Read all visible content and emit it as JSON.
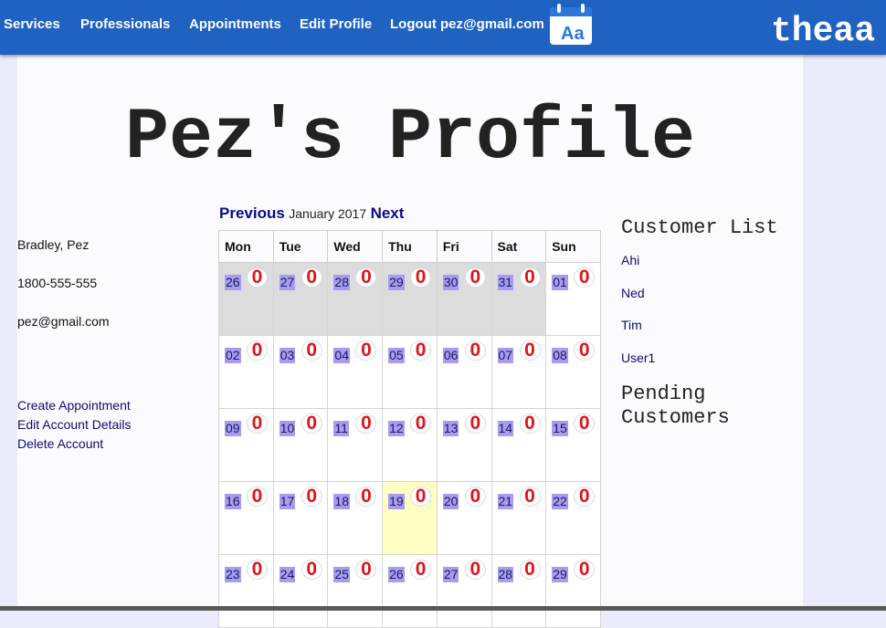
{
  "nav": {
    "items": [
      {
        "label": "Services"
      },
      {
        "label": "Professionals"
      },
      {
        "label": "Appointments"
      },
      {
        "label": "Edit Profile"
      },
      {
        "label": "Logout pez@gmail.com"
      }
    ],
    "brand_icon": "calendar-icon",
    "brand_icon_text": "Aa",
    "brand_text": "theaa"
  },
  "page_title": "Pez's Profile",
  "profile": {
    "name": "Bradley, Pez",
    "phone": "1800-555-555",
    "email": "pez@gmail.com"
  },
  "actions": [
    {
      "label": "Create Appointment"
    },
    {
      "label": "Edit Account Details"
    },
    {
      "label": "Delete Account"
    }
  ],
  "calendar": {
    "prev_label": "Previous",
    "month_label": "January 2017",
    "next_label": "Next",
    "day_headers": [
      "Mon",
      "Tue",
      "Wed",
      "Thu",
      "Fri",
      "Sat",
      "Sun"
    ],
    "weeks": [
      [
        {
          "day": "26",
          "count": "0",
          "other": true
        },
        {
          "day": "27",
          "count": "0",
          "other": true
        },
        {
          "day": "28",
          "count": "0",
          "other": true
        },
        {
          "day": "29",
          "count": "0",
          "other": true
        },
        {
          "day": "30",
          "count": "0",
          "other": true
        },
        {
          "day": "31",
          "count": "0",
          "other": true
        },
        {
          "day": "01",
          "count": "0"
        }
      ],
      [
        {
          "day": "02",
          "count": "0"
        },
        {
          "day": "03",
          "count": "0"
        },
        {
          "day": "04",
          "count": "0"
        },
        {
          "day": "05",
          "count": "0"
        },
        {
          "day": "06",
          "count": "0"
        },
        {
          "day": "07",
          "count": "0"
        },
        {
          "day": "08",
          "count": "0"
        }
      ],
      [
        {
          "day": "09",
          "count": "0"
        },
        {
          "day": "10",
          "count": "0"
        },
        {
          "day": "11",
          "count": "0"
        },
        {
          "day": "12",
          "count": "0"
        },
        {
          "day": "13",
          "count": "0"
        },
        {
          "day": "14",
          "count": "0"
        },
        {
          "day": "15",
          "count": "0"
        }
      ],
      [
        {
          "day": "16",
          "count": "0"
        },
        {
          "day": "17",
          "count": "0"
        },
        {
          "day": "18",
          "count": "0"
        },
        {
          "day": "19",
          "count": "0",
          "today": true
        },
        {
          "day": "20",
          "count": "0"
        },
        {
          "day": "21",
          "count": "0"
        },
        {
          "day": "22",
          "count": "0"
        }
      ],
      [
        {
          "day": "23",
          "count": "0"
        },
        {
          "day": "24",
          "count": "0"
        },
        {
          "day": "25",
          "count": "0"
        },
        {
          "day": "26",
          "count": "0"
        },
        {
          "day": "27",
          "count": "0"
        },
        {
          "day": "28",
          "count": "0"
        },
        {
          "day": "29",
          "count": "0"
        }
      ]
    ]
  },
  "customer_list": {
    "heading": "Customer List",
    "items": [
      {
        "label": "Ahi"
      },
      {
        "label": "Ned"
      },
      {
        "label": "Tim"
      },
      {
        "label": "User1"
      }
    ]
  },
  "pending": {
    "heading": "Pending\nCustomers"
  },
  "colors": {
    "navbar": "#1f62c1",
    "page_bg": "#fbfbff",
    "body_bg": "#ebebfb",
    "link": "#0b0b84",
    "day_highlight": "#a79cf2",
    "today": "#ffffc4",
    "other_month": "#dcdcdc",
    "badge": "#e0141b"
  }
}
